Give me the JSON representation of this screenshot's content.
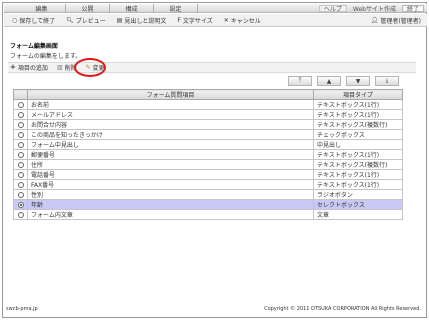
{
  "topnav": {
    "tabs": [
      {
        "label": "編集"
      },
      {
        "label": "公開"
      },
      {
        "label": "構成"
      },
      {
        "label": "設定"
      }
    ],
    "help": "ヘルプ",
    "create": "Webサイト作成",
    "exit": "終了"
  },
  "toolbar": {
    "save_label": "保存して終了",
    "preview_label": "プレビュー",
    "heading_label": "見出しと説明文",
    "font_label": "文字サイズ",
    "cancel_label": "キャンセル",
    "user_label": "管理者(管理者)"
  },
  "page": {
    "title": "フォーム編集画面",
    "subtitle": "フォームの編集をします。"
  },
  "actions": {
    "add_label": "項目の追加",
    "delete_label": "削除",
    "edit_label": "変更"
  },
  "table": {
    "headers": [
      "",
      "フォーム質問項目",
      "項目タイプ"
    ],
    "rows": [
      {
        "question": "お名前",
        "type": "テキストボックス(1行)",
        "selected": false
      },
      {
        "question": "メールアドレス",
        "type": "テキストボックス(1行)",
        "selected": false
      },
      {
        "question": "お問合せ内容",
        "type": "テキストボックス(複数行)",
        "selected": false
      },
      {
        "question": "この商品を知ったきっかけ",
        "type": "チェックボックス",
        "selected": false
      },
      {
        "question": "フォーム中見出し",
        "type": "中見出し",
        "selected": false
      },
      {
        "question": "郵便番号",
        "type": "テキストボックス(1行)",
        "selected": false
      },
      {
        "question": "住所",
        "type": "テキストボックス(複数行)",
        "selected": false
      },
      {
        "question": "電話番号",
        "type": "テキストボックス(1行)",
        "selected": false
      },
      {
        "question": "FAX番号",
        "type": "テキストボックス(1行)",
        "selected": false
      },
      {
        "question": "性別",
        "type": "ラジオボタン",
        "selected": false
      },
      {
        "question": "年齢",
        "type": "セレクトボックス",
        "selected": true
      },
      {
        "question": "フォーム内文章",
        "type": "文章",
        "selected": false
      }
    ]
  },
  "footer": {
    "left": "swcb-pma.jp",
    "right": "Copyright © 2011 OTSUKA CORPORATION All Rights Reserved."
  },
  "colors": {
    "selected_row": "#c9c9f5",
    "highlight_circle": "#e01818"
  }
}
